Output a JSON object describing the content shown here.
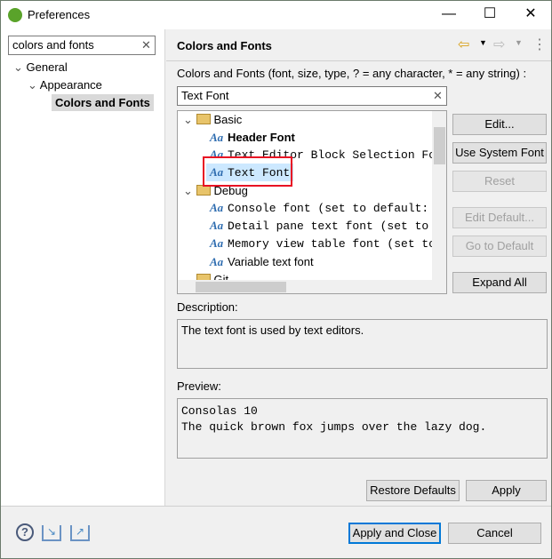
{
  "window": {
    "title": "Preferences",
    "minimize": "—",
    "maximize": "☐",
    "close": "✕"
  },
  "sidebar": {
    "search_value": "colors and fonts",
    "clear": "✕",
    "items": [
      {
        "label": "General"
      },
      {
        "label": "Appearance"
      },
      {
        "label": "Colors and Fonts"
      }
    ]
  },
  "main": {
    "title": "Colors and Fonts",
    "back": "⇦",
    "forward": "⇨",
    "menu": "⋮",
    "filter_label": "Colors and Fonts (font, size, type, ? = any character, * = any string) :",
    "filter_value": "Text Font",
    "filter_clear": "✕",
    "tree": {
      "groups": [
        {
          "label": "Basic",
          "items": [
            "Header Font",
            "Text Editor Block Selection Font",
            "Text Font"
          ]
        },
        {
          "label": "Debug",
          "items": [
            "Console font (set to default: Text Font)",
            "Detail pane text font (set to default: Text Font)",
            "Memory view table font (set to default: Text Font)",
            "Variable text font"
          ]
        },
        {
          "label": "Git"
        }
      ],
      "selected": "Text Font",
      "icon_text": "Aa"
    },
    "buttons": {
      "edit": "Edit...",
      "use_system": "Use System Font",
      "reset": "Reset",
      "edit_default": "Edit Default...",
      "go_default": "Go to Default",
      "expand_all": "Expand All"
    },
    "description_label": "Description:",
    "description": "The text font is used by text editors.",
    "preview_label": "Preview:",
    "preview_line1": "Consolas 10",
    "preview_line2": "The quick brown fox jumps over the lazy dog.",
    "restore_defaults": "Restore Defaults",
    "apply": "Apply"
  },
  "footer": {
    "help": "?",
    "apply_close": "Apply and Close",
    "cancel": "Cancel"
  },
  "colors": {
    "selection": "#cce8ff",
    "highlight_box": "#e81123",
    "accent": "#0078d7"
  }
}
